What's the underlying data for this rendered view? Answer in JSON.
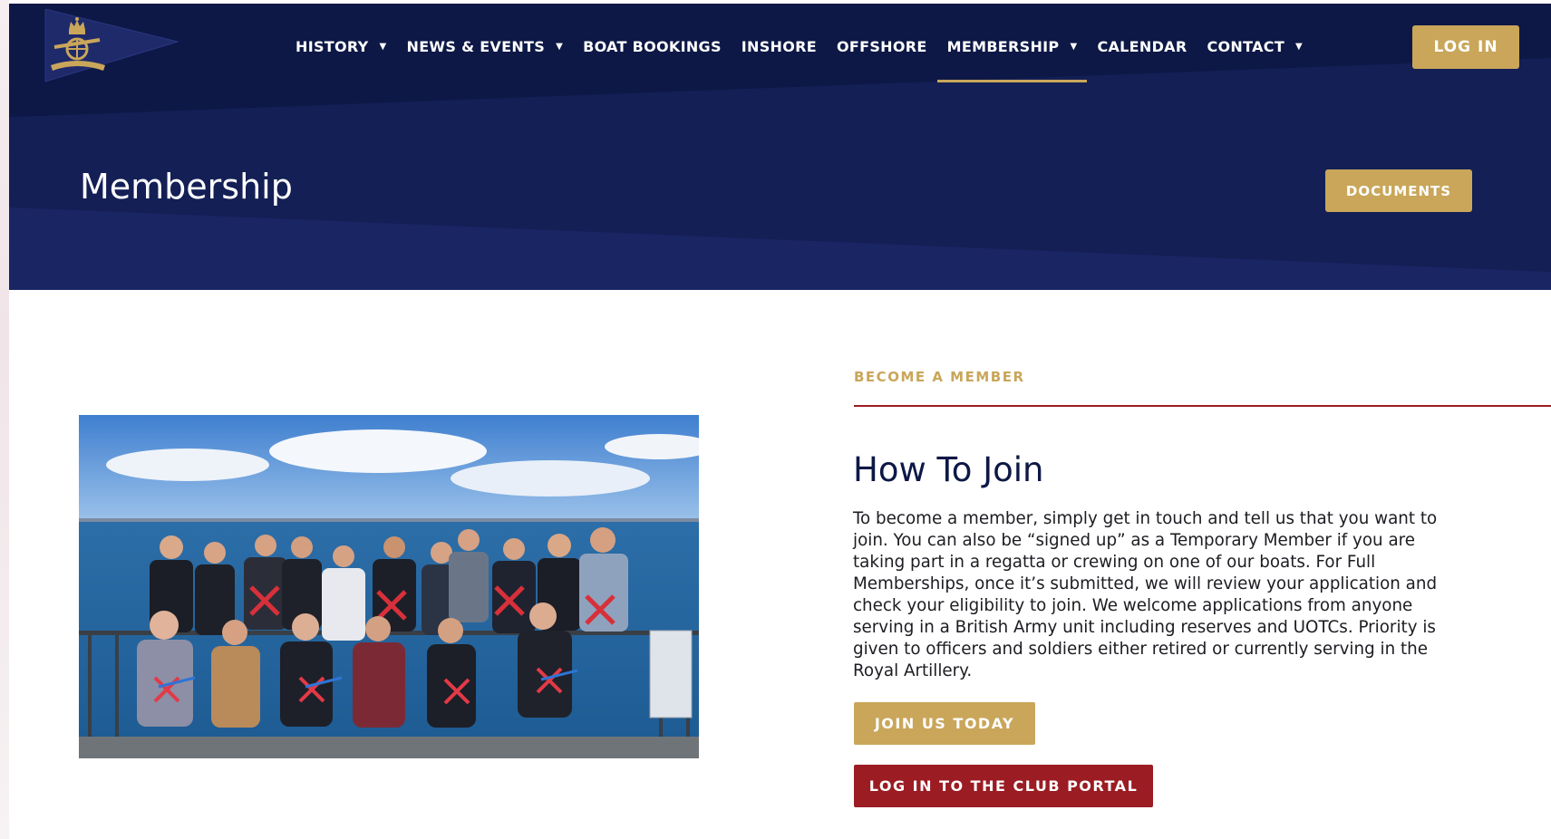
{
  "brand": {
    "logo_icon": "royal-artillery-pennant-icon",
    "gold": "#c9a65a",
    "navy": "#0d1846",
    "crimson": "#9b1c23"
  },
  "nav": {
    "items": [
      {
        "label": "HISTORY",
        "has_dropdown": true
      },
      {
        "label": "NEWS & EVENTS",
        "has_dropdown": true
      },
      {
        "label": "BOAT BOOKINGS",
        "has_dropdown": false
      },
      {
        "label": "INSHORE",
        "has_dropdown": false
      },
      {
        "label": "OFFSHORE",
        "has_dropdown": false
      },
      {
        "label": "MEMBERSHIP",
        "has_dropdown": true,
        "active": true
      },
      {
        "label": "CALENDAR",
        "has_dropdown": false
      },
      {
        "label": "CONTACT",
        "has_dropdown": true
      }
    ],
    "login_label": "LOG IN"
  },
  "hero": {
    "title": "Membership",
    "documents_label": "DOCUMENTS"
  },
  "content": {
    "eyebrow": "BECOME A MEMBER",
    "heading": "How To Join",
    "body": "To become a member, simply get in touch and tell us that you want to join. You can also be “signed up” as a Temporary Member if you are taking part in a regatta or crewing on one of our boats.  For Full Memberships, once it’s submitted, we will review your application and check your eligibility to join. We welcome applications from anyone serving in a British Army unit including reserves and UOTCs.  Priority is given to officers and soldiers either retired or currently serving in the Royal Artillery.",
    "join_label": "JOIN US TODAY",
    "portal_label": "LOG IN TO THE CLUB PORTAL"
  }
}
